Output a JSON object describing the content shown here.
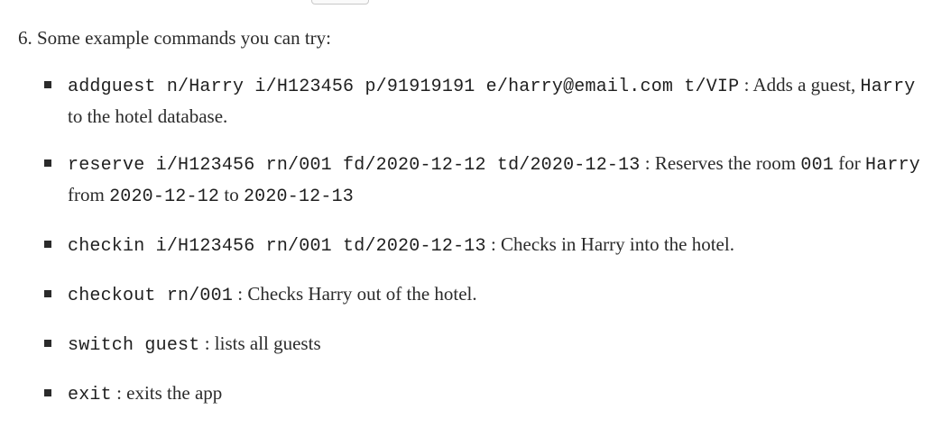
{
  "step": {
    "text": "6. Some example commands you can try:"
  },
  "commands": [
    {
      "code": "addguest n/Harry i/H123456 p/91919191 e/harry@email.com t/VIP",
      "desc_a": ": Adds a guest,",
      "code_b": "Harry",
      "desc_b": "to the hotel database."
    },
    {
      "code": "reserve i/H123456 rn/001 fd/2020-12-12 td/2020-12-13",
      "desc_a": ": Reserves the room",
      "code_b": "001",
      "desc_b": "for",
      "code_c": "Harry",
      "desc_c": "from",
      "code_d": "2020-12-12",
      "desc_d": "to",
      "code_e": "2020-12-13"
    },
    {
      "code": "checkin i/H123456 rn/001 td/2020-12-13",
      "desc_a": ": Checks in Harry into the hotel."
    },
    {
      "code": "checkout rn/001",
      "desc_a": ": Checks Harry out of the hotel."
    },
    {
      "code": "switch guest",
      "desc_a": ": lists all guests"
    },
    {
      "code": "exit",
      "desc_a": ": exits the app"
    }
  ]
}
